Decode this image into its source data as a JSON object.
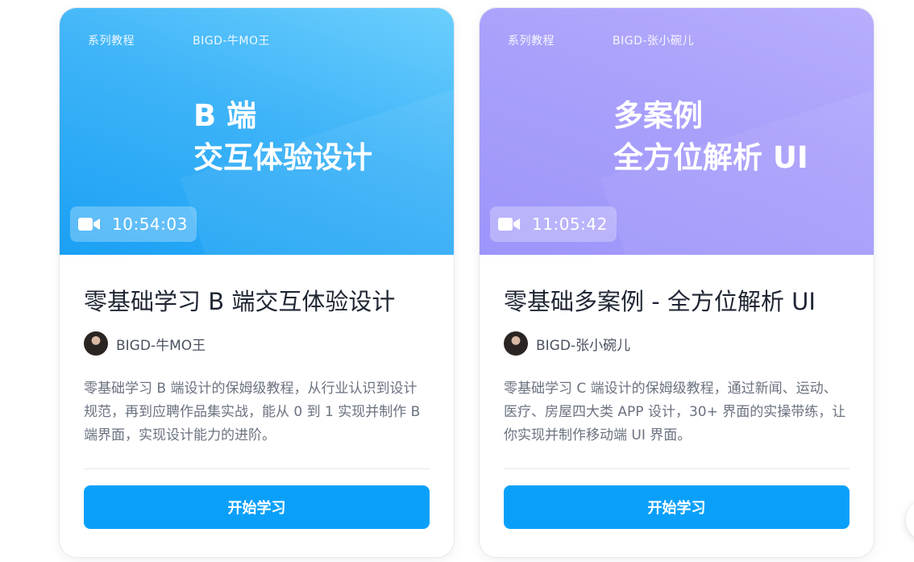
{
  "courses": [
    {
      "tag": "系列教程",
      "cover_author": "BIGD-牛MO王",
      "cover_title_line1": "B 端",
      "cover_title_line2": "交互体验设计",
      "duration": "10:54:03",
      "title": "零基础学习 B 端交互体验设计",
      "author": "BIGD-牛MO王",
      "description": "零基础学习 B 端设计的保姆级教程，从行业认识到设计规范，再到应聘作品集实战，能从 0 到 1 实现并制作 B 端界面，实现设计能力的进阶。",
      "button_label": "开始学习",
      "cover_color": "#3fb4f8"
    },
    {
      "tag": "系列教程",
      "cover_author": "BIGD-张小碗儿",
      "cover_title_line1": "多案例",
      "cover_title_line2": "全方位解析 UI",
      "duration": "11:05:42",
      "title": "零基础多案例 - 全方位解析 UI",
      "author": "BIGD-张小碗儿",
      "description": "零基础学习 C 端设计的保姆级教程，通过新闻、运动、医疗、房屋四大类 APP 设计，30+ 界面的实操带练，让你实现并制作移动端 UI 界面。",
      "button_label": "开始学习",
      "cover_color": "#a9a0fb"
    }
  ],
  "colors": {
    "primary_button": "#0aa0fa",
    "title_text": "#1f2633",
    "body_text": "#6b7280"
  },
  "icons": {
    "duration": "video-camera-icon"
  }
}
